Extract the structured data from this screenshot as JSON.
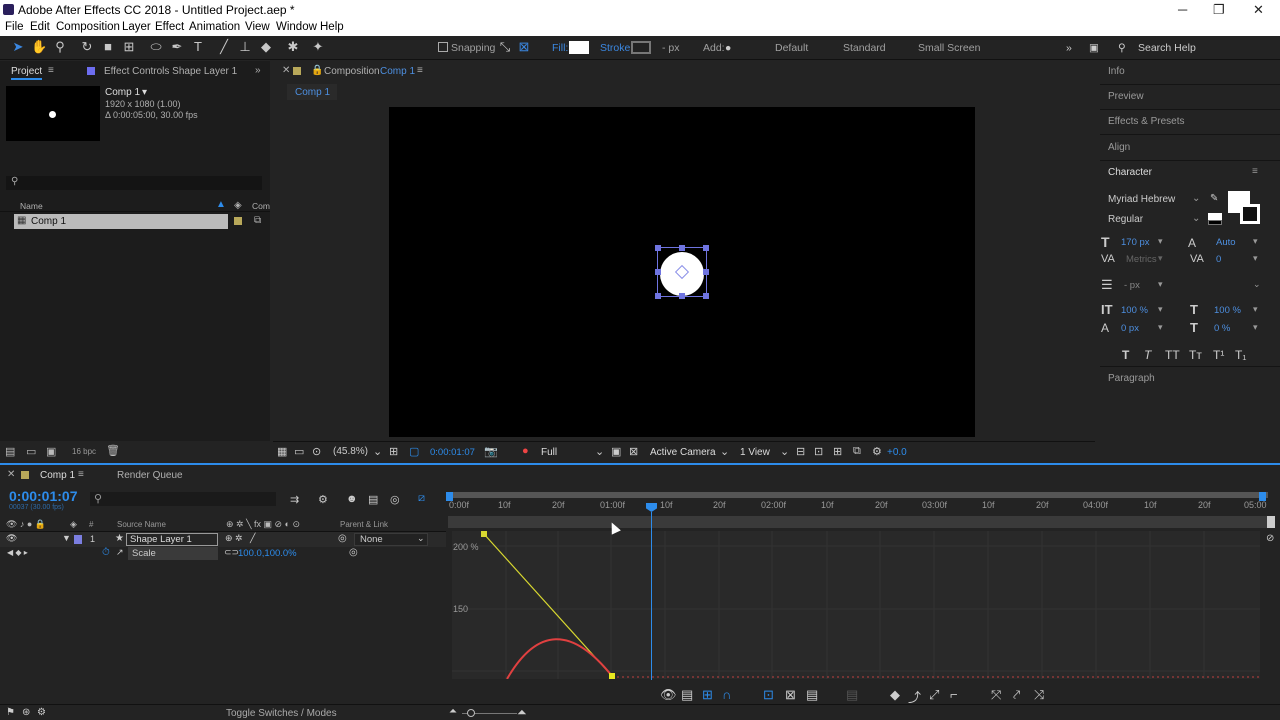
{
  "window": {
    "title": "Adobe After Effects CC 2018 - Untitled Project.aep *",
    "min": "─",
    "max": "❐",
    "close": "✕"
  },
  "menu": [
    "File",
    "Edit",
    "Composition",
    "Layer",
    "Effect",
    "Animation",
    "View",
    "Window",
    "Help"
  ],
  "toolbar": {
    "snapping": "Snapping",
    "fill": "Fill:",
    "stroke": "Stroke:",
    "px": "- px",
    "add": "Add:",
    "workspaces": [
      "Default",
      "Standard",
      "Small Screen"
    ],
    "search_help": "Search Help"
  },
  "project_panel": {
    "tab": "Project",
    "effect_controls_tab": "Effect Controls Shape Layer 1",
    "comp_name": "Comp 1",
    "comp_size": "1920 x 1080 (1.00)",
    "comp_duration": "Δ 0:00:05:00, 30.00 fps",
    "search_placeholder": "",
    "col_name": "Name",
    "col_comment": "Com",
    "items": [
      "Comp 1"
    ],
    "bpc": "16 bpc"
  },
  "comp_panel": {
    "tab_prefix": "Composition",
    "tab_name": "Comp 1",
    "sub_tab": "Comp 1",
    "zoom": "(45.8%)",
    "timecode": "0:00:01:07",
    "resolution": "Full",
    "camera": "Active Camera",
    "view": "1 View",
    "exposure": "+0.0"
  },
  "right_panel": {
    "sections": [
      "Info",
      "Preview",
      "Effects & Presets",
      "Align"
    ],
    "character": {
      "title": "Character",
      "font": "Myriad Hebrew",
      "style": "Regular",
      "size": "170 px",
      "leading": "Auto",
      "kerning": "Metrics",
      "tracking": "0",
      "stroke_px": "- px",
      "vscale": "100 %",
      "hscale": "100 %",
      "baseline": "0 px",
      "tsume": "0 %",
      "styles": [
        "T",
        "T",
        "TT",
        "Tт",
        "T¹",
        "T₁"
      ]
    },
    "paragraph": "Paragraph"
  },
  "timeline": {
    "tab": "Comp 1",
    "render_queue": "Render Queue",
    "timecode": "0:00:01:07",
    "timecode_sub": "00037 (30.00 fps)",
    "col_source": "Source Name",
    "col_parent": "Parent & Link",
    "layer_num": "1",
    "layer_name": "Shape Layer 1",
    "parent_value": "None",
    "property": "Scale",
    "property_value": "100.0,100.0%",
    "ruler": [
      "0:00f",
      "10f",
      "20f",
      "01:00f",
      "10f",
      "20f",
      "02:00f",
      "10f",
      "20f",
      "03:00f",
      "10f",
      "20f",
      "04:00f",
      "10f",
      "20f",
      "05:00"
    ],
    "graph_labels": [
      "200 %",
      "150"
    ],
    "toggle": "Toggle Switches / Modes"
  },
  "colors": {
    "accent": "#2d8ceb",
    "yellow_curve": "#d8d830",
    "red_curve": "#e04040",
    "label_swatch": "#7b7ee0"
  }
}
